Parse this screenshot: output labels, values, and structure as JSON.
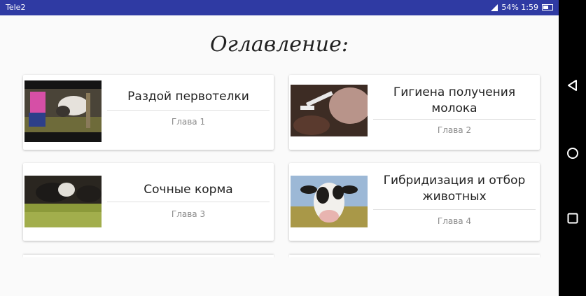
{
  "status": {
    "carrier": "Tele2",
    "right_text": "54% 1:59"
  },
  "page_title": "Оглавление:",
  "cards": [
    {
      "title": "Раздой первотелки",
      "chapter": "Глава 1"
    },
    {
      "title": "Гигиена получения молока",
      "chapter": "Глава 2"
    },
    {
      "title": "Сочные корма",
      "chapter": "Глава 3"
    },
    {
      "title": "Гибридизация и отбор животных",
      "chapter": "Глава 4"
    }
  ],
  "icons": {
    "signal": "signal-icon",
    "battery": "battery-icon",
    "back": "back-triangle-icon",
    "home": "home-circle-icon",
    "recents": "recents-square-icon"
  },
  "colors": {
    "status_bar": "#2f3aa3",
    "nav_bar": "#000000",
    "card_bg": "#ffffff"
  }
}
